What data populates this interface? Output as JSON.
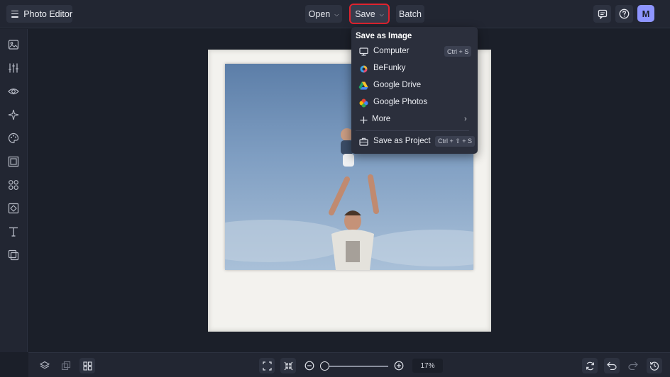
{
  "app": {
    "title": "Photo Editor"
  },
  "toolbar": {
    "open_label": "Open",
    "save_label": "Save",
    "batch_label": "Batch",
    "avatar_initial": "M",
    "save_highlight_color": "#e0232f",
    "avatar_color": "#8e95ff"
  },
  "sidebar": {
    "icons": [
      "image-icon",
      "sliders-icon",
      "eye-icon",
      "sparkle-effects-icon",
      "palette-icon",
      "frame-icon",
      "shapes-icon",
      "graphics-icon",
      "text-icon",
      "layers-collage-icon"
    ]
  },
  "save_menu": {
    "heading": "Save as Image",
    "items": [
      {
        "label": "Computer",
        "shortcut": "Ctrl + S",
        "icon": "monitor-icon"
      },
      {
        "label": "BeFunky",
        "icon": "befunky-icon"
      },
      {
        "label": "Google Drive",
        "icon": "google-drive-icon"
      },
      {
        "label": "Google Photos",
        "icon": "google-photos-icon"
      },
      {
        "label": "More",
        "icon": "plus-icon"
      },
      {
        "label": "Save as Project",
        "shortcut": "Ctrl + ⇧ + S",
        "icon": "briefcase-icon"
      }
    ]
  },
  "bottom": {
    "zoom": "17%",
    "zoom_fraction": 0.0
  }
}
